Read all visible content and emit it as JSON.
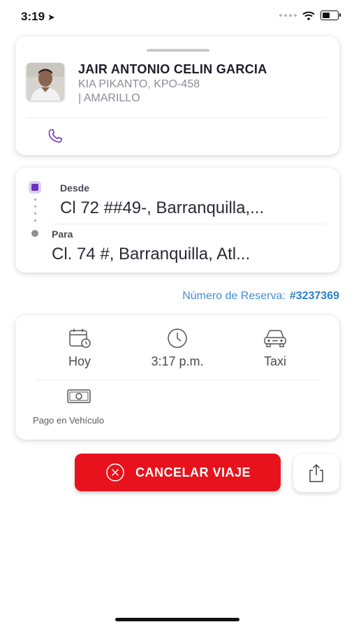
{
  "status": {
    "time": "3:19"
  },
  "driver": {
    "name": "JAIR ANTONIO CELIN GARCIA",
    "vehicle": "KIA PIKANTO, KPO-458",
    "color": "| AMARILLO"
  },
  "route": {
    "from_label": "Desde",
    "from_address": "Cl 72 ##49-, Barranquilla,...",
    "to_label": "Para",
    "to_address": "Cl. 74 #, Barranquilla, Atl..."
  },
  "reservation": {
    "label": "Número de Reserva:",
    "number": "#3237369"
  },
  "details": {
    "date": "Hoy",
    "time": "3:17 p.m.",
    "service": "Taxi",
    "payment": "Pago en Vehículo"
  },
  "actions": {
    "cancel_label": "CANCELAR VIAJE"
  },
  "colors": {
    "accent": "#6d2fbf",
    "cancel": "#e8121c",
    "link": "#3d8fd4"
  },
  "icons": [
    "location-arrow-icon",
    "wifi-icon",
    "battery-icon",
    "phone-icon",
    "calendar-icon",
    "clock-icon",
    "car-icon",
    "cash-icon",
    "close-circle-icon",
    "share-icon"
  ]
}
